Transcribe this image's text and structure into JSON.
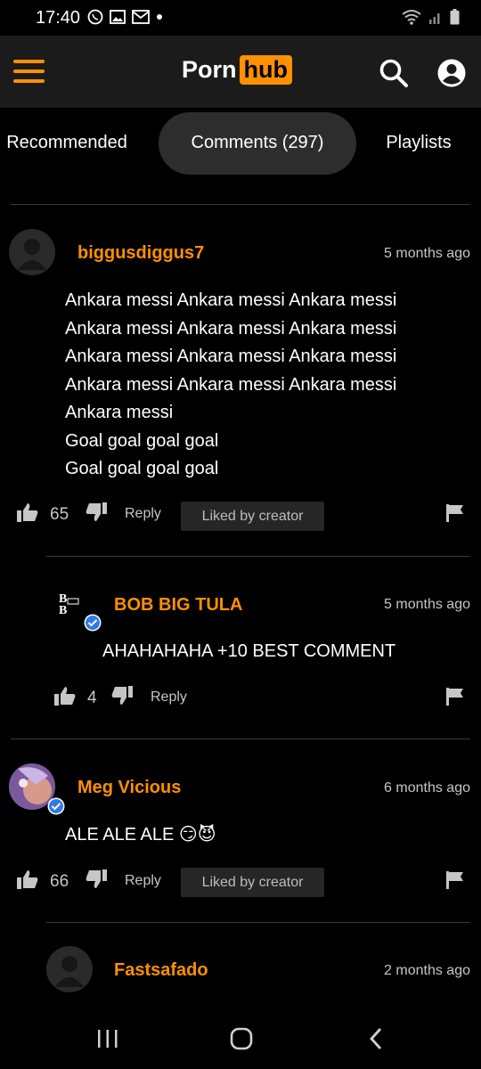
{
  "status_bar": {
    "time": "17:40"
  },
  "header": {
    "logo_part1": "Porn",
    "logo_part2": "hub",
    "colors": {
      "accent": "#ff9000",
      "header_bg": "#1b1b1b"
    }
  },
  "tabs": [
    {
      "label": "Recommended",
      "active": false
    },
    {
      "label": "Comments (297)",
      "active": true
    },
    {
      "label": "Playlists",
      "active": false
    }
  ],
  "comments": [
    {
      "username": "biggusdiggus7",
      "time": "5 months ago",
      "lines": [
        "Ankara messi Ankara messi Ankara messi",
        "Ankara messi Ankara messi Ankara messi",
        "Ankara messi Ankara messi Ankara messi",
        "Ankara messi Ankara messi Ankara messi",
        "Ankara messi",
        "Goal goal goal goal",
        "Goal goal goal goal"
      ],
      "likes": "65",
      "reply_label": "Reply",
      "liked_label": "Liked by creator"
    },
    {
      "username": "BOB BIG TULA",
      "time": "5 months ago",
      "text": "AHAHAHAHA +10 BEST COMMENT",
      "likes": "4",
      "reply_label": "Reply"
    },
    {
      "username": "Meg Vicious",
      "time": "6 months ago",
      "text": "ALE ALE ALE 😏😈",
      "likes": "66",
      "reply_label": "Reply",
      "liked_label": "Liked by creator"
    },
    {
      "username": "Fastsafado",
      "time": "2 months ago"
    }
  ]
}
